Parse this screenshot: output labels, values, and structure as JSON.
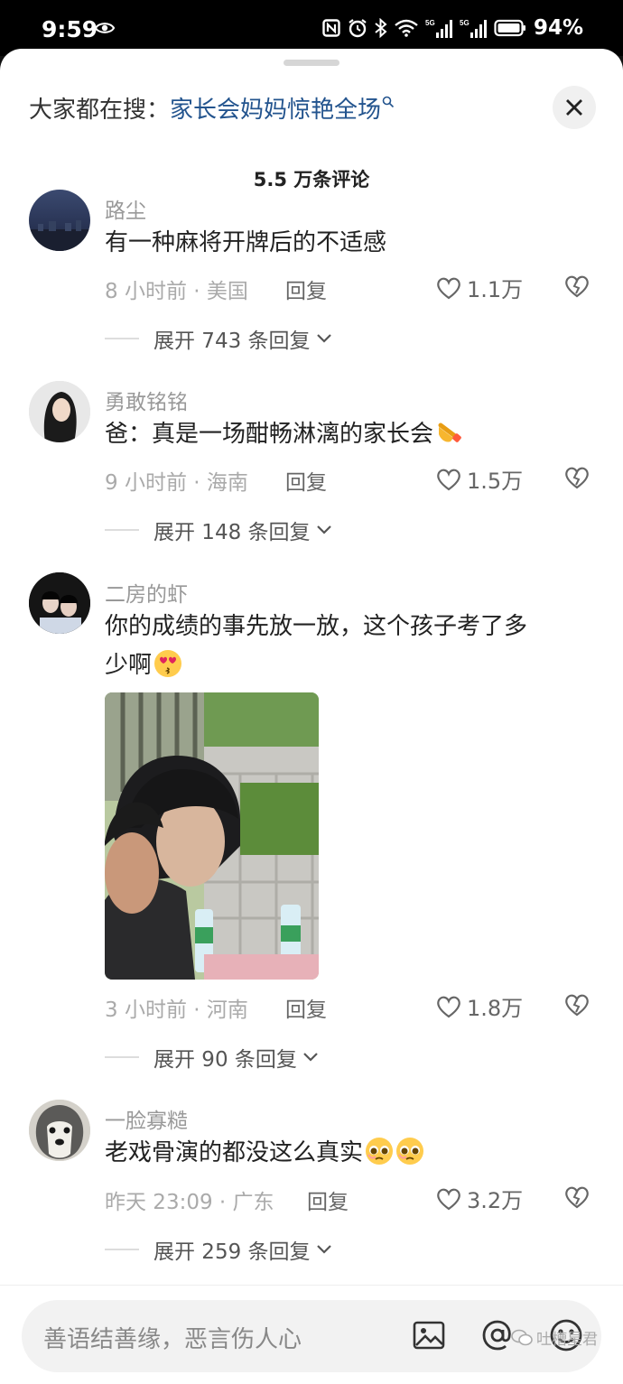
{
  "status_bar": {
    "time": "9:59",
    "battery": "94%",
    "signal_label": "5G"
  },
  "search": {
    "prefix": "大家都在搜：",
    "term": "家长会妈妈惊艳全场"
  },
  "comments_header": "5.5 万条评论",
  "comments": [
    {
      "user": "路尘",
      "text": "有一种麻将开牌后的不适感",
      "time_location": "8 小时前 · 美国",
      "reply": "回复",
      "likes": "1.1万",
      "expand": "展开 743 条回复"
    },
    {
      "user": "勇敢铭铭",
      "text": "爸：真是一场酣畅淋漓的家长会",
      "time_location": "9 小时前 · 海南",
      "reply": "回复",
      "likes": "1.5万",
      "expand": "展开 148 条回复"
    },
    {
      "user": "二房的虾",
      "text_line1": "你的成绩的事先放一放，这个孩子考了多",
      "text_line2": "少啊",
      "time_location": "3 小时前 · 河南",
      "reply": "回复",
      "likes": "1.8万",
      "expand": "展开 90 条回复"
    },
    {
      "user": "一脸寡糙",
      "text": "老戏骨演的都没这么真实",
      "time_location": "昨天 23:09 · 广东",
      "reply": "回复",
      "likes": "3.2万",
      "expand": "展开 259 条回复"
    }
  ],
  "input": {
    "placeholder": "善语结善缘，恶言伤人心"
  },
  "watermark": "吐槽星君",
  "colors": {
    "link": "#23548e",
    "muted": "#aaaaaa",
    "background": "#ffffff"
  },
  "icons": [
    "eye-icon",
    "nfc-icon",
    "alarm-icon",
    "bluetooth-icon",
    "wifi-icon",
    "signal-icon",
    "battery-icon",
    "search-icon",
    "close-icon",
    "heart-icon",
    "broken-heart-icon",
    "chevron-down-icon",
    "image-icon",
    "at-icon",
    "emoji-icon",
    "wechat-icon"
  ]
}
